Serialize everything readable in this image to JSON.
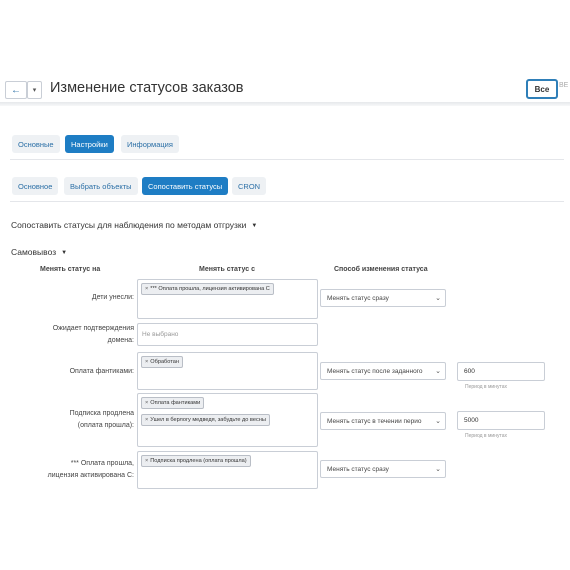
{
  "header": {
    "title": "Изменение статусов заказов",
    "back_icon": "←",
    "dropdown_icon": "▾",
    "all_label": "Все",
    "extra_label": "ВЕ"
  },
  "main_tabs": [
    "Основные",
    "Настройки",
    "Информация"
  ],
  "sub_tabs": [
    "Основное",
    "Выбрать объекты",
    "Сопоставить статусы",
    "CRON"
  ],
  "section_title": "Сопоставить статусы для наблюдения по методам отгрузки",
  "group_title": "Самовывоз",
  "caret": "▼",
  "columns": {
    "change_on": "Менять статус на",
    "change_from": "Менять статус с",
    "method": "Способ изменения статуса"
  },
  "rows": [
    {
      "label": "Дети унесли:",
      "chips": [
        "*** Оплата прошла, лицензия активирована С"
      ],
      "select": "Менять статус сразу"
    },
    {
      "label_lines": [
        "Ожидает подтверждения",
        "домена:"
      ],
      "placeholder": "Не выбрано"
    },
    {
      "label": "Оплата фантиками:",
      "chips": [
        "Обработан"
      ],
      "select": "Менять статус после заданного",
      "number": "600",
      "hint": "Период в минутах"
    },
    {
      "label_lines": [
        "Подписка продлена",
        "(оплата прошла):"
      ],
      "chips": [
        "Оплата фантиками",
        "Ушел в берлогу медведя, забудьте до весны"
      ],
      "select": "Менять статус в течении перио",
      "number": "5000",
      "hint": "Период в минутах"
    },
    {
      "label_lines": [
        "*** Оплата прошла,",
        "лицензия активирована С:"
      ],
      "chips": [
        "Подписка продлена (оплата прошла)"
      ],
      "select": "Менять статус сразу"
    }
  ],
  "chip_remove": "×",
  "select_arrow": "⌄",
  "colors": {
    "accent": "#1e7dc4",
    "tab_light_bg": "#eef1f4",
    "border": "#c9ced6"
  }
}
